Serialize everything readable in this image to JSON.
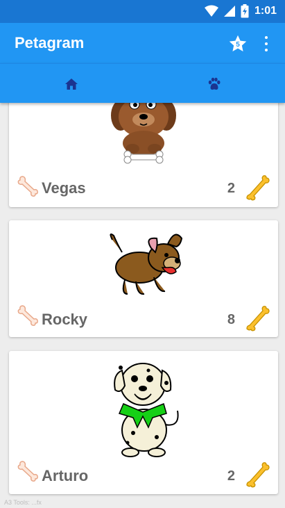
{
  "status_bar": {
    "time": "1:01"
  },
  "app_bar": {
    "title": "Petagram",
    "favorites_count": "5"
  },
  "tabs": [
    {
      "name": "home",
      "icon": "home-icon"
    },
    {
      "name": "paw",
      "icon": "paw-icon"
    }
  ],
  "pets": [
    {
      "name": "Vegas",
      "likes": "2"
    },
    {
      "name": "Rocky",
      "likes": "8"
    },
    {
      "name": "Arturo",
      "likes": "2"
    }
  ],
  "colors": {
    "primary": "#2196f3",
    "primary_dark": "#1976d2",
    "bone_gold": "#fbc02d",
    "text_gray": "#666666"
  },
  "watermark": "A3 Tools: ...fx"
}
